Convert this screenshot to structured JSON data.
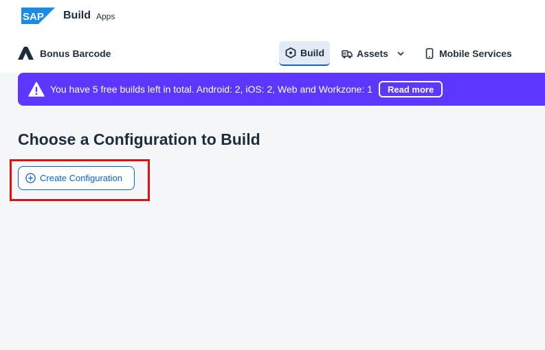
{
  "topbar": {
    "logo": "SAP",
    "product": "Build",
    "product_sub": "Apps"
  },
  "appbar": {
    "app_icon": "app-logo-icon",
    "app_name": "Bonus Barcode",
    "nav": [
      {
        "label": "Build",
        "icon": "build-icon",
        "active": true
      },
      {
        "label": "Assets",
        "icon": "assets-icon",
        "has_menu": true
      },
      {
        "label": "Mobile Services",
        "icon": "mobile-icon"
      }
    ]
  },
  "banner": {
    "icon": "warning-icon",
    "text": "You have 5 free builds left in total. Android: 2, iOS: 2, Web and Workzone: 1",
    "action_label": "Read more",
    "color": "#5d36ff"
  },
  "main": {
    "title": "Choose a Configuration to Build",
    "create_label": "Create Configuration",
    "highlight_color": "#e0100f",
    "accent_color": "#0064d9"
  }
}
